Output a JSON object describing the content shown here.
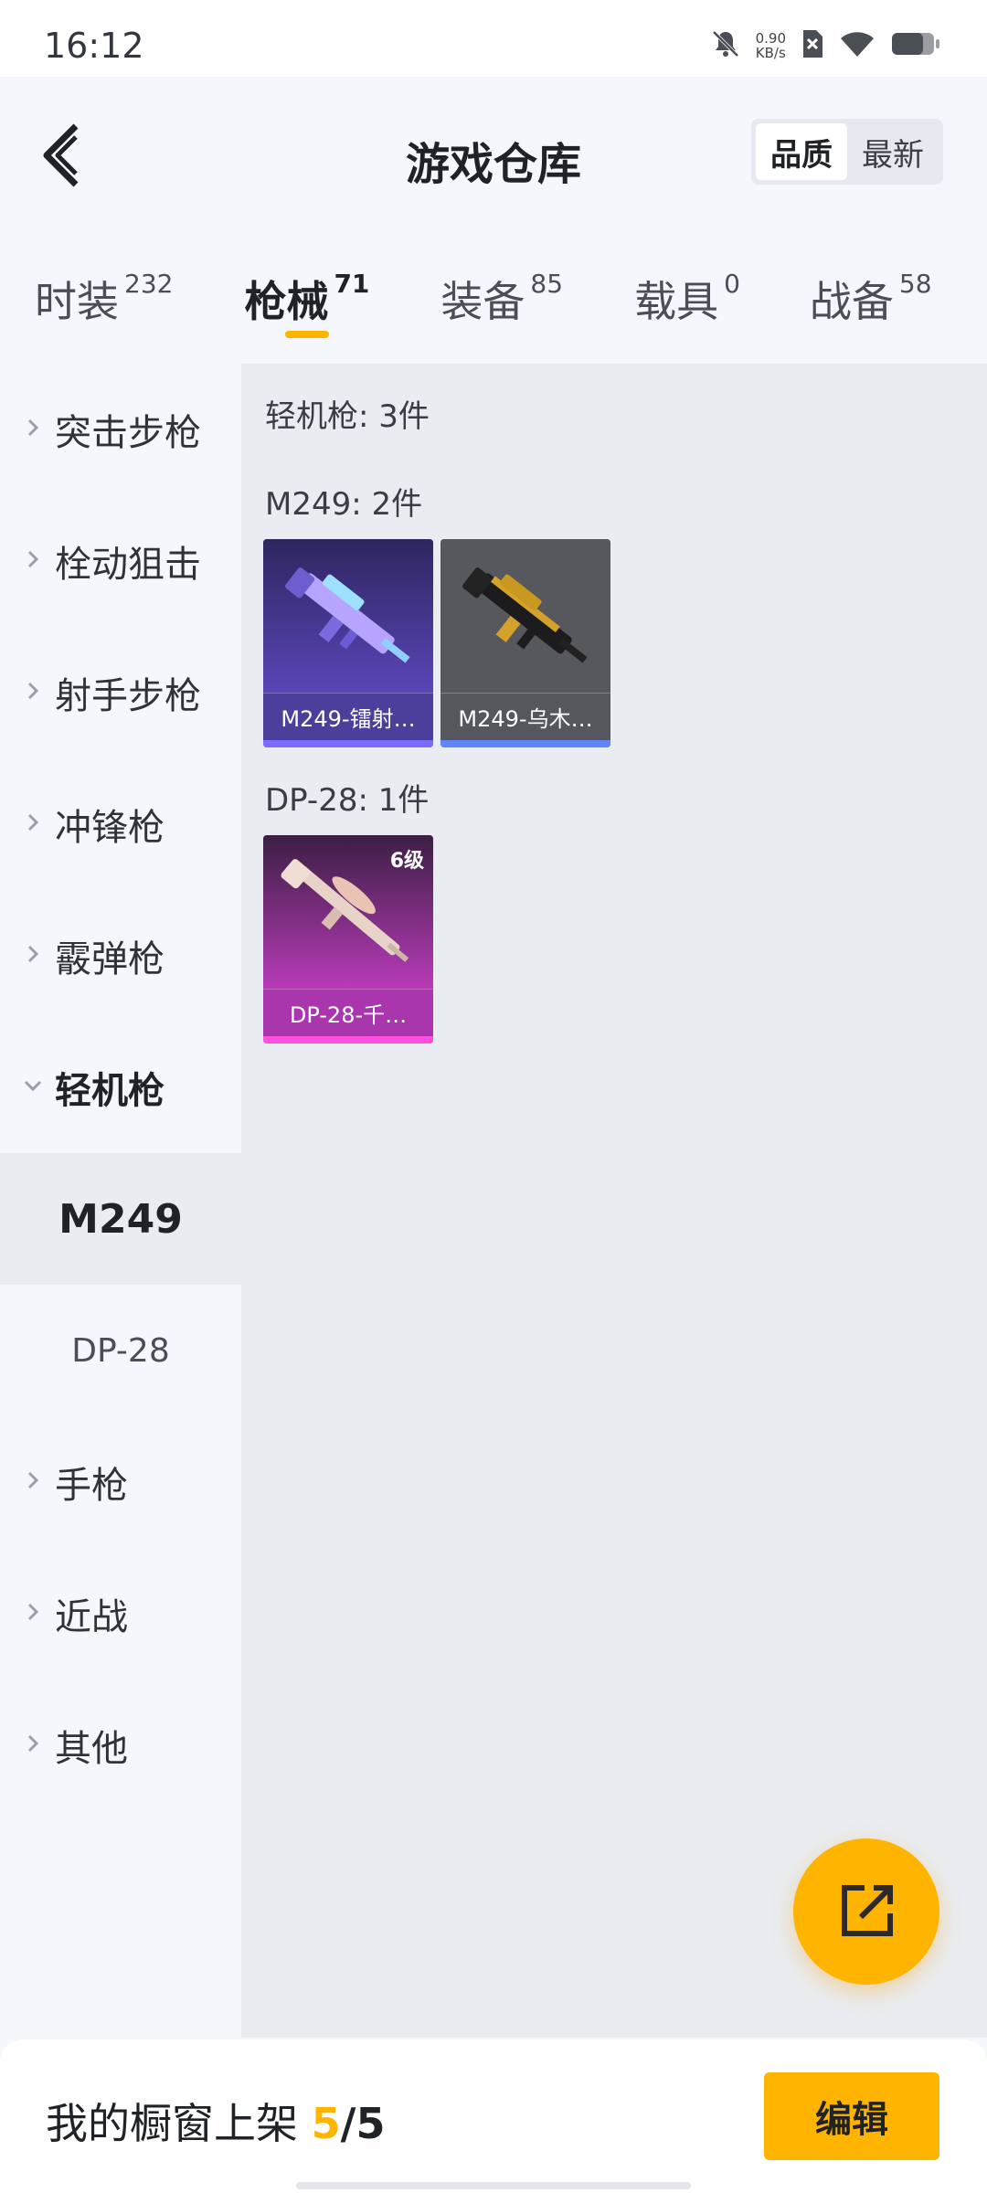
{
  "status_bar": {
    "time": "16:12",
    "net_speed_value": "0.90",
    "net_speed_unit": "KB/s",
    "icons": [
      "bell-muted-icon",
      "sim-off-icon",
      "wifi-icon",
      "battery-icon"
    ]
  },
  "header": {
    "title": "游戏仓库",
    "sort_options": [
      "品质",
      "最新"
    ],
    "active_sort": "品质"
  },
  "tabs": [
    {
      "label": "时装",
      "count": "232"
    },
    {
      "label": "枪械",
      "count": "71"
    },
    {
      "label": "装备",
      "count": "85"
    },
    {
      "label": "载具",
      "count": "0"
    },
    {
      "label": "战备",
      "count": "58"
    }
  ],
  "active_tab": "枪械",
  "sidebar": {
    "categories": [
      {
        "label": "突击步枪"
      },
      {
        "label": "栓动狙击"
      },
      {
        "label": "射手步枪"
      },
      {
        "label": "冲锋枪"
      },
      {
        "label": "霰弹枪"
      },
      {
        "label": "轻机枪",
        "expanded": true,
        "sub": [
          "M249",
          "DP-28"
        ],
        "selected_sub": "M249"
      },
      {
        "label": "手枪"
      },
      {
        "label": "近战"
      },
      {
        "label": "其他"
      }
    ]
  },
  "content": {
    "category_title": "轻机枪: 3件",
    "groups": [
      {
        "title": "M249: 2件",
        "items": [
          {
            "name": "M249-镭射…",
            "level": "",
            "bar_color": "#7b6cff",
            "bg_top": "#3a2f6e",
            "bg_bottom": "#5b43b5"
          },
          {
            "name": "M249-乌木…",
            "level": "",
            "bar_color": "#5f86ff",
            "bg_top": "#55575c",
            "bg_bottom": "#4a4c52"
          }
        ]
      },
      {
        "title": "DP-28: 1件",
        "items": [
          {
            "name": "DP-28-千…",
            "level": "6级",
            "bar_color": "#ff4fe0",
            "bg_top": "#3a1f42",
            "bg_bottom": "#b43ab5"
          }
        ]
      }
    ]
  },
  "fab": {
    "icon": "share-icon"
  },
  "bottom_bar": {
    "shelf_label": "我的橱窗上架",
    "shelf_current": "5",
    "shelf_sep": "/",
    "shelf_max": "5",
    "edit_label": "编辑"
  },
  "colors": {
    "accent": "#ffb400"
  }
}
